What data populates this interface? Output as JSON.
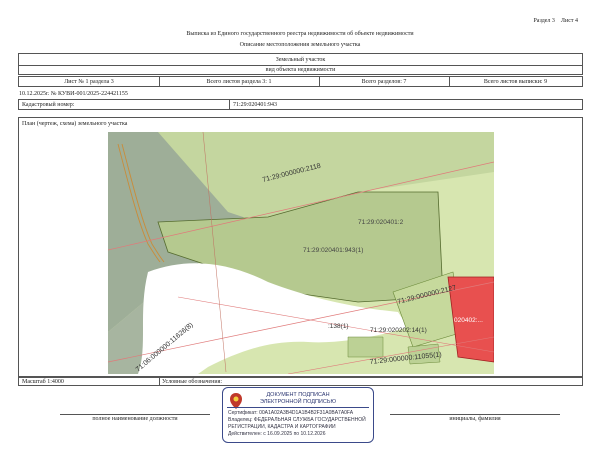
{
  "header": {
    "section_label": "Раздел 3",
    "sheet_label": "Лист 4",
    "title": "Выписка из Единого государственного реестра недвижимости об объекте недвижимости",
    "subtitle": "Описание местоположения земельного участка"
  },
  "object_block": {
    "object_type": "Земельный участок",
    "object_caption": "вид объекта недвижимости"
  },
  "sheet_row": {
    "sheet_section": "Лист № 1 раздела 3",
    "sheets_in_section": "Всего листов раздела 3: 1",
    "sections_total": "Всего разделов: 7",
    "sheets_total": "Всего листов выписки: 9"
  },
  "meta": {
    "date_number": "10.12.2025г. № КУВИ-001/2025-224421155",
    "cadastral_label": "Кадастровый номер:",
    "cadastral_number": "71:29:020401:943"
  },
  "plan": {
    "title": "План (чертеж, схема) земельного участка",
    "labels": {
      "parcel_top": "71:29:000000:2118",
      "parcel_mid_1": "71:29:020401:2",
      "parcel_mid_2": "71:29:020401:943(1)",
      "parcel_left": "71:06:000000:11626(8)",
      "parcel_right": "71:29:000000:2127",
      "parcel_red": "020402:...",
      "parcel_small_1": ":138(1)",
      "parcel_small_2": "71:29:020202:14(1)",
      "parcel_bottom": "71:29:000000:11055(1)"
    },
    "colors": {
      "main_green": "#b5c98f",
      "light_green": "#d7e6b0",
      "grey_green": "#9eae98",
      "red_parcel": "#e8504f",
      "white_area": "#ffffff"
    }
  },
  "footer": {
    "scale": "Масштаб 1:4000",
    "legend_label": "Условные обозначения:",
    "position_caption": "полное наименование должности",
    "name_caption": "инициалы, фамилия"
  },
  "stamp": {
    "title_1": "ДОКУМЕНТ ПОДПИСАН",
    "title_2": "ЭЛЕКТРОННОЙ ПОДПИСЬЮ",
    "line_1": "Сертификат: 00A1A02A3B4D1A1B4B2F31A0BA7A0FA",
    "line_2": "Владелец: ФЕДЕРАЛЬНАЯ СЛУЖБА ГОСУДАРСТВЕННОЙ",
    "line_3": "РЕГИСТРАЦИИ, КАДАСТРА И КАРТОГРАФИИ",
    "line_4": "Действителен: с 16.09.2025 по 10.12.2026",
    "emblem_color": "#c0392b"
  }
}
